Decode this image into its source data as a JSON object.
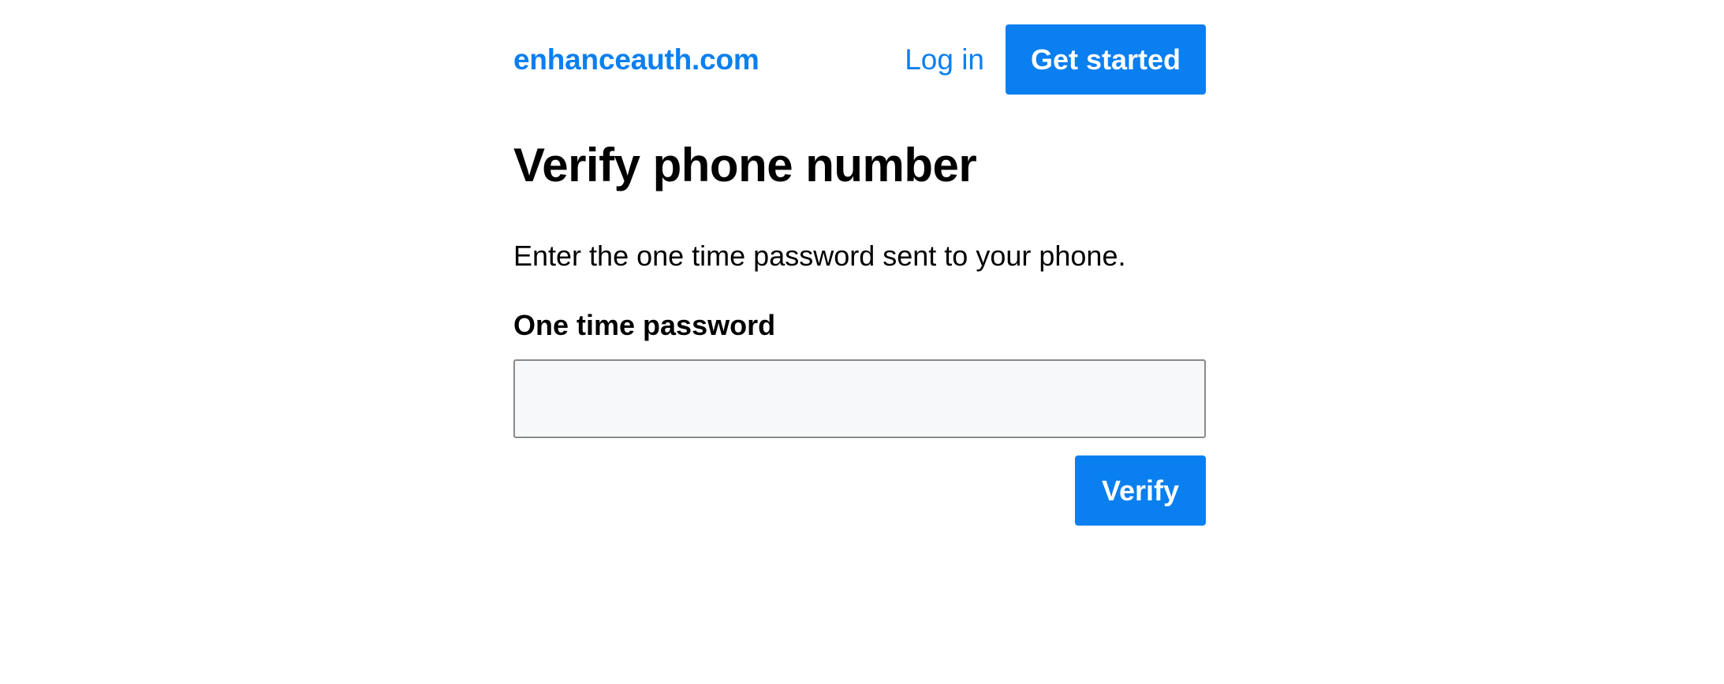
{
  "header": {
    "brand": "enhanceauth.com",
    "login_label": "Log in",
    "get_started_label": "Get started"
  },
  "main": {
    "title": "Verify phone number",
    "description": "Enter the one time password sent to your phone.",
    "otp_label": "One time password",
    "otp_value": "",
    "verify_label": "Verify"
  },
  "colors": {
    "accent": "#0a7ff0",
    "input_background": "#f7f8f9",
    "input_border": "#8a8a8a"
  }
}
